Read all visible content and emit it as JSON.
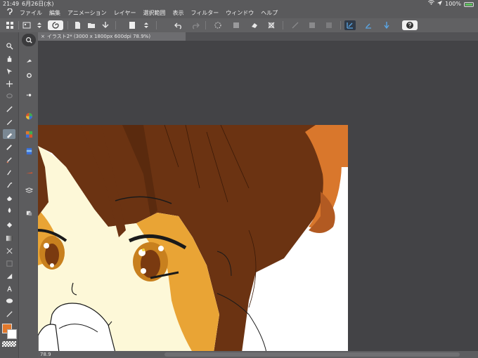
{
  "status": {
    "time": "21:49",
    "date": "6月26日(水)",
    "battery_pct": "100%"
  },
  "menu": {
    "items": [
      "ファイル",
      "編集",
      "アニメーション",
      "レイヤー",
      "選択範囲",
      "表示",
      "フィルター",
      "ウィンドウ",
      "ヘルプ"
    ]
  },
  "canvas": {
    "tab_title": "イラスト2* (3000 x 1800px 600dpi 78.9%)",
    "zoom": "78.9"
  },
  "colors": {
    "main": "#e0782c",
    "sub": "#ffffff"
  }
}
